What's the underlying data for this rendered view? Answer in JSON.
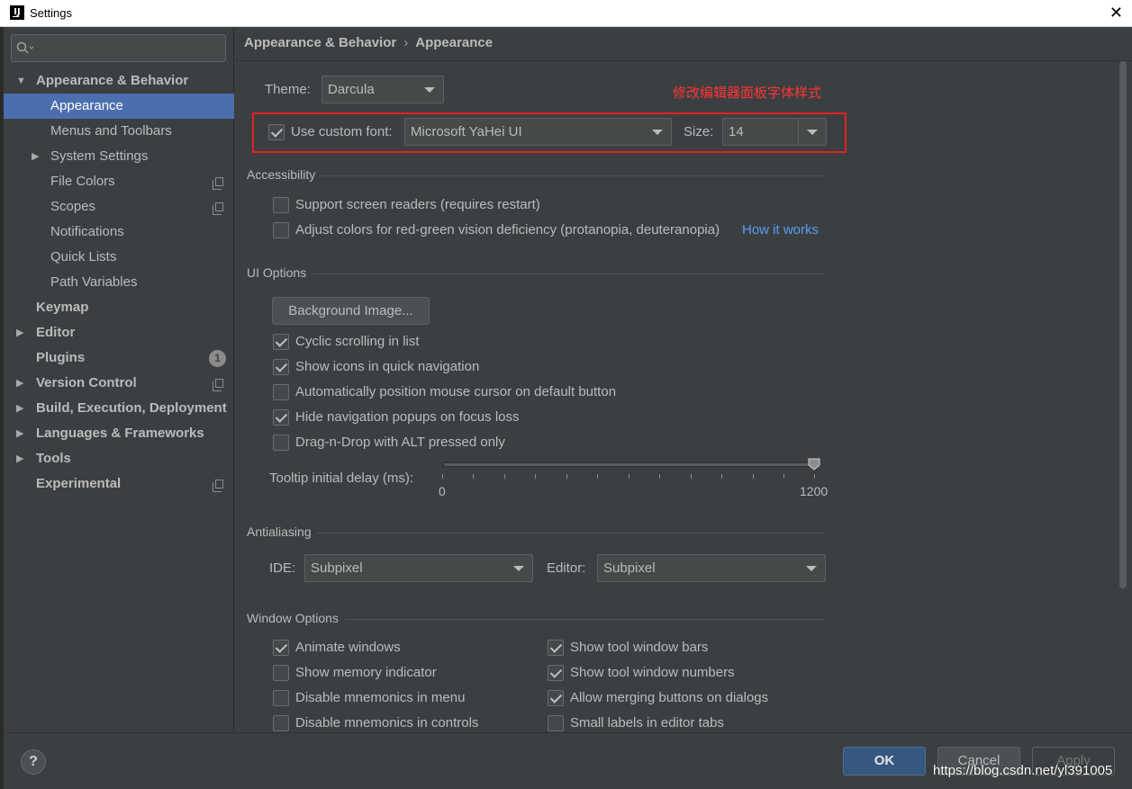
{
  "window": {
    "title": "Settings",
    "close_glyph": "✕"
  },
  "sidebar": {
    "items": [
      {
        "label": "Appearance & Behavior",
        "arrow": "▼"
      },
      {
        "label": "Appearance"
      },
      {
        "label": "Menus and Toolbars"
      },
      {
        "label": "System Settings",
        "arrow": "▶"
      },
      {
        "label": "File Colors"
      },
      {
        "label": "Scopes"
      },
      {
        "label": "Notifications"
      },
      {
        "label": "Quick Lists"
      },
      {
        "label": "Path Variables"
      },
      {
        "label": "Keymap"
      },
      {
        "label": "Editor",
        "arrow": "▶"
      },
      {
        "label": "Plugins",
        "badge": "1"
      },
      {
        "label": "Version Control",
        "arrow": "▶"
      },
      {
        "label": "Build, Execution, Deployment",
        "arrow": "▶"
      },
      {
        "label": "Languages & Frameworks",
        "arrow": "▶"
      },
      {
        "label": "Tools",
        "arrow": "▶"
      },
      {
        "label": "Experimental"
      }
    ]
  },
  "breadcrumb": {
    "parent": "Appearance & Behavior",
    "separator": "›",
    "current": "Appearance"
  },
  "theme": {
    "label": "Theme:",
    "value": "Darcula"
  },
  "annotation": "修改编辑器面板字体样式",
  "custom_font": {
    "label": "Use custom font:",
    "checked": true,
    "value": "Microsoft YaHei UI",
    "size_label": "Size:",
    "size_value": "14"
  },
  "accessibility": {
    "title": "Accessibility",
    "screen_readers": "Support screen readers (requires restart)",
    "color_adjust": "Adjust colors for red-green vision deficiency (protanopia, deuteranopia)",
    "how_it_works": "How it works"
  },
  "ui_options": {
    "title": "UI Options",
    "background_image": "Background Image...",
    "options": [
      {
        "label": "Cyclic scrolling in list",
        "checked": true
      },
      {
        "label": "Show icons in quick navigation",
        "checked": true
      },
      {
        "label": "Automatically position mouse cursor on default button",
        "checked": false
      },
      {
        "label": "Hide navigation popups on focus loss",
        "checked": true
      },
      {
        "label": "Drag-n-Drop with ALT pressed only",
        "checked": false
      }
    ],
    "tooltip_label": "Tooltip initial delay (ms):",
    "tooltip_min": "0",
    "tooltip_max": "1200",
    "tooltip_value": 1200
  },
  "antialiasing": {
    "title": "Antialiasing",
    "ide_label": "IDE:",
    "ide_value": "Subpixel",
    "editor_label": "Editor:",
    "editor_value": "Subpixel"
  },
  "window_options": {
    "title": "Window Options",
    "left": [
      {
        "label": "Animate windows",
        "checked": true
      },
      {
        "label": "Show memory indicator",
        "checked": false
      },
      {
        "label": "Disable mnemonics in menu",
        "checked": false
      },
      {
        "label": "Disable mnemonics in controls",
        "checked": false
      }
    ],
    "right": [
      {
        "label": "Show tool window bars",
        "checked": true
      },
      {
        "label": "Show tool window numbers",
        "checked": true
      },
      {
        "label": "Allow merging buttons on dialogs",
        "checked": true
      },
      {
        "label": "Small labels in editor tabs",
        "checked": false
      }
    ]
  },
  "footer": {
    "help": "?",
    "ok": "OK",
    "cancel": "Cancel",
    "apply": "Apply",
    "watermark": "https://blog.csdn.net/yl391005"
  }
}
